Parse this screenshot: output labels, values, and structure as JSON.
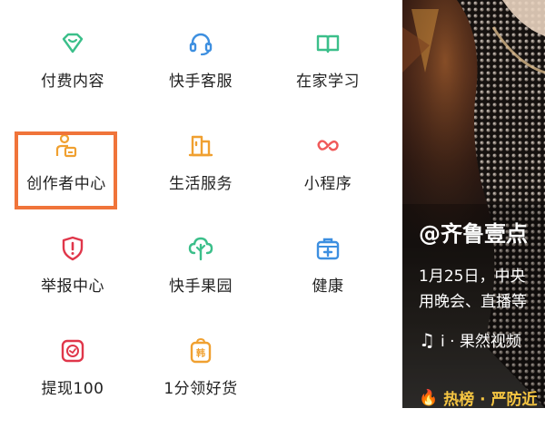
{
  "menu": {
    "items": [
      {
        "label": "付费内容",
        "icon": "diamond-icon",
        "color": "#3bbf8a"
      },
      {
        "label": "快手客服",
        "icon": "headset-icon",
        "color": "#3d8fe0"
      },
      {
        "label": "在家学习",
        "icon": "book-icon",
        "color": "#3bbf8a"
      },
      {
        "label": "创作者中心",
        "icon": "creator-icon",
        "color": "#f0a030"
      },
      {
        "label": "生活服务",
        "icon": "shop-icon",
        "color": "#f0a030"
      },
      {
        "label": "小程序",
        "icon": "infinity-icon",
        "color": "#f05a5a"
      },
      {
        "label": "举报中心",
        "icon": "shield-alert-icon",
        "color": "#e0364a"
      },
      {
        "label": "快手果园",
        "icon": "tree-icon",
        "color": "#3bbf8a"
      },
      {
        "label": "健康",
        "icon": "medkit-icon",
        "color": "#3d8fe0"
      },
      {
        "label": "提现100",
        "icon": "cash-icon",
        "color": "#e0364a"
      },
      {
        "label": "1分领好货",
        "icon": "gift-bag-icon",
        "color": "#f0a030"
      }
    ],
    "highlight_color": "#f0743a"
  },
  "video": {
    "author": "@齐鲁壹点",
    "desc_line1": "1月25日，中央",
    "desc_line2": "用晚会、直播等",
    "music": "i · 果然视频",
    "hot": "热榜 · 严防近"
  }
}
